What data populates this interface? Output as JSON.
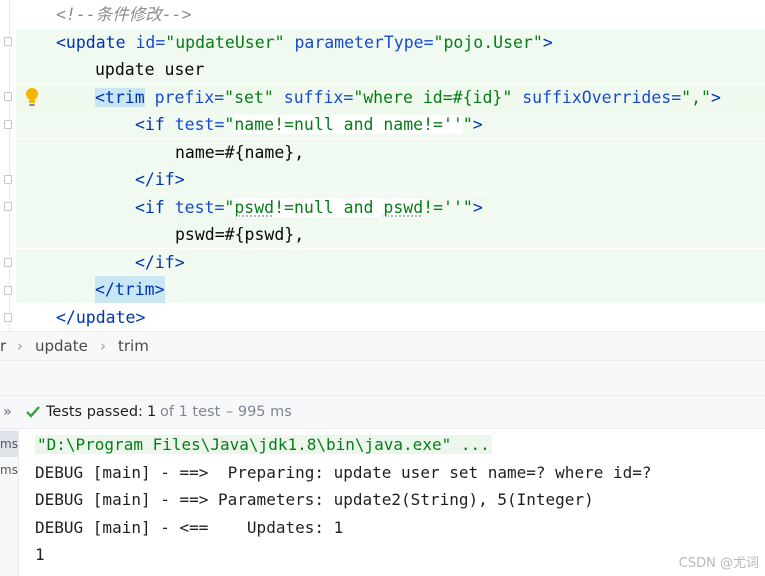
{
  "editor": {
    "comment": "<!--条件修改-->",
    "update_open": {
      "tag": "<update",
      "attr1": " id=",
      "val1": "\"updateUser\"",
      "attr2": " parameterType=",
      "val2": "\"pojo.User\"",
      "close": ">"
    },
    "update_text": "update user",
    "trim_open": {
      "tag": "<trim",
      "attr1": " prefix=",
      "val1": "\"set\"",
      "attr2": " suffix=",
      "val2": "\"where id=#{id}\"",
      "attr3": " suffixOverrides=",
      "val3": "\",\"",
      "close": ">"
    },
    "if1_open": {
      "tag": "<if",
      "attr": " test=",
      "val_a": "\"",
      "val_b": "name!=null and name!=''",
      "val_c": "\"",
      "close": ">"
    },
    "if1_body": "name=#{name},",
    "if1_close": "</if>",
    "if2_open": {
      "tag": "<if",
      "attr": " test=",
      "val_a": "\"",
      "val_b": "pswd",
      "val_c": "!=null and ",
      "val_d": "pswd",
      "val_e": "!=''\"",
      "close": ">"
    },
    "if2_body": "pswd=#{pswd},",
    "if2_close": "</if>",
    "trim_close": "</trim>",
    "update_close": "</update>"
  },
  "breadcrumb": {
    "left_fragment": "r",
    "items": [
      "update",
      "trim"
    ],
    "separator": "›"
  },
  "testbar": {
    "expand": "»",
    "status_label": "Tests passed:",
    "passed": "1",
    "of_total": "of 1 test",
    "duration": "– 995 ms"
  },
  "console": {
    "left_ms": [
      "ms",
      "ms"
    ],
    "lines": [
      "\"D:\\Program Files\\Java\\jdk1.8\\bin\\java.exe\" ...",
      "DEBUG [main] - ==>  Preparing: update user set name=? where id=?",
      "DEBUG [main] - ==> Parameters: update2(String), 5(Integer)",
      "DEBUG [main] - <==    Updates: 1",
      "1"
    ]
  },
  "watermark": "CSDN @尤词",
  "colors": {
    "tag": "#0033b3",
    "attribute": "#174ad4",
    "string": "#067d17",
    "comment": "#8c8c8c",
    "pass_check": "#3c9d3c"
  }
}
